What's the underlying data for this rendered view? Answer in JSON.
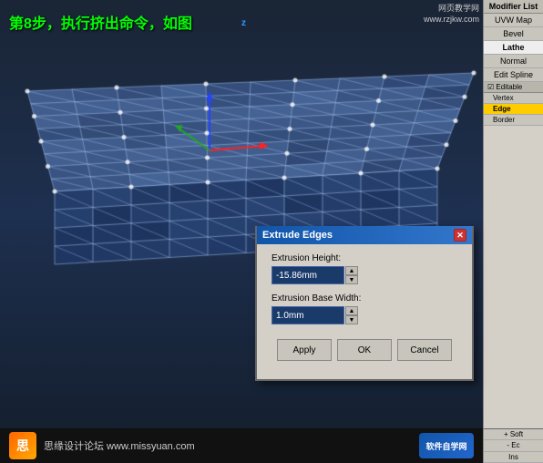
{
  "annotation": {
    "text": "第8步，执行挤出命令，如图"
  },
  "watermark": {
    "top_line1": "网页教学网",
    "top_line2": "www.rzjkw.com",
    "bottom_site": "思缘设计论坛  www.missyuan.com",
    "logo_right": "软件自学网"
  },
  "right_panel": {
    "title": "Modifier List",
    "items": [
      {
        "label": "UVW Map",
        "id": "uvw-map"
      },
      {
        "label": "Bevel",
        "id": "bevel"
      },
      {
        "label": "Lathe",
        "id": "lathe"
      },
      {
        "label": "Normal",
        "id": "normal"
      },
      {
        "label": "Edit Spline",
        "id": "edit-spline"
      }
    ],
    "editable_section": "Editable",
    "sub_items": [
      {
        "label": "Vertex",
        "id": "vertex",
        "selected": false
      },
      {
        "label": "Edge",
        "id": "edge",
        "selected": true
      },
      {
        "label": "Border",
        "id": "border",
        "selected": false
      }
    ]
  },
  "bottom_right": {
    "btn1": "+ Soft",
    "btn2": "- Ec",
    "btn3": "Ins"
  },
  "dialog": {
    "title": "Extrude Edges",
    "close_label": "✕",
    "field1_label": "Extrusion Height:",
    "field1_value": "-15.86mm",
    "field2_label": "Extrusion Base Width:",
    "field2_value": "1.0mm",
    "btn_apply": "Apply",
    "btn_ok": "OK",
    "btn_cancel": "Cancel"
  },
  "axis": {
    "z_label": "z"
  }
}
